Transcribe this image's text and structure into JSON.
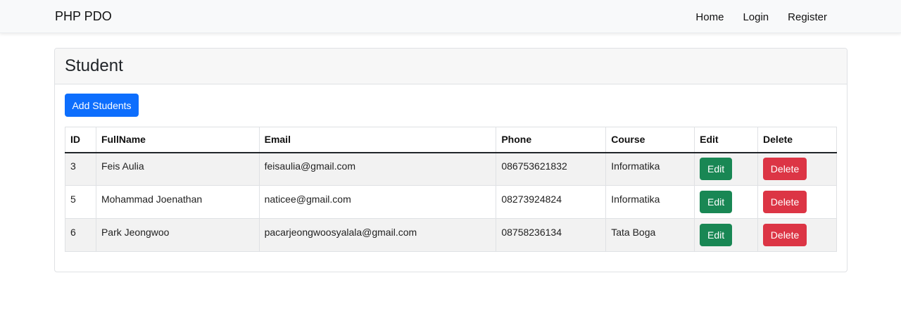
{
  "navbar": {
    "brand": "PHP PDO",
    "links": [
      "Home",
      "Login",
      "Register"
    ]
  },
  "card": {
    "title": "Student",
    "add_button": "Add Students"
  },
  "table": {
    "headers": [
      "ID",
      "FullName",
      "Email",
      "Phone",
      "Course",
      "Edit",
      "Delete"
    ],
    "rows": [
      {
        "id": "3",
        "fullname": "Feis Aulia",
        "email": "feisaulia@gmail.com",
        "phone": "086753621832",
        "course": "Informatika",
        "edit": "Edit",
        "delete": "Delete"
      },
      {
        "id": "5",
        "fullname": "Mohammad Joenathan",
        "email": "naticee@gmail.com",
        "phone": "08273924824",
        "course": "Informatika",
        "edit": "Edit",
        "delete": "Delete"
      },
      {
        "id": "6",
        "fullname": "Park Jeongwoo",
        "email": "pacarjeongwoosyalala@gmail.com",
        "phone": "08758236134",
        "course": "Tata Boga",
        "edit": "Edit",
        "delete": "Delete"
      }
    ]
  },
  "colors": {
    "primary": "#0d6efd",
    "success": "#198754",
    "danger": "#dc3545",
    "navbar_bg": "#f8f9fa"
  }
}
